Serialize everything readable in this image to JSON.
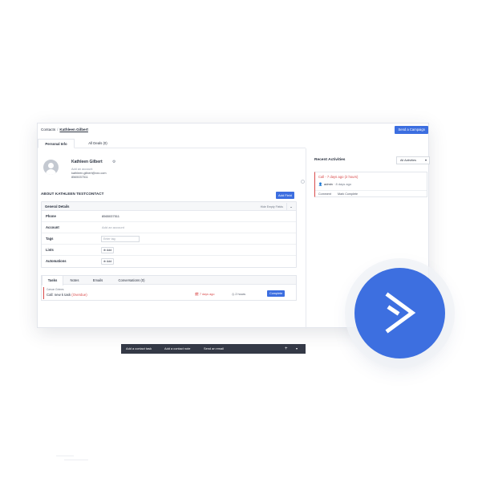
{
  "header": {
    "breadcrumb_root": "Contacts",
    "breadcrumb_sep": "/",
    "breadcrumb_current": "Kathleen Gilbert",
    "send_campaign_label": "Send a Campaign"
  },
  "tabs": [
    {
      "label": "Personal Info",
      "active": true
    },
    {
      "label": "All Deals (0)",
      "active": false
    }
  ],
  "contact": {
    "name": "Kathleen Gilbert",
    "account_link": "Add an account",
    "email": "kathleen.gilbert@xxx.com",
    "phone": "8565037511"
  },
  "about": {
    "title": "ABOUT KATHLEEN TESTCONTACT",
    "add_field_label": "Add Field"
  },
  "general_details": {
    "title": "General Details",
    "hide_empty_label": "Hide Empty Fields",
    "rows": [
      {
        "label": "Phone",
        "value": "8565037511"
      },
      {
        "label": "Account",
        "placeholder": "Add an account"
      },
      {
        "label": "Tags",
        "input_placeholder": "Enter tag"
      },
      {
        "label": "Lists",
        "add_label": "Add"
      },
      {
        "label": "Automations",
        "add_label": "Add"
      }
    ]
  },
  "task_tabs": [
    {
      "label": "Tasks",
      "active": true
    },
    {
      "label": "Notes",
      "active": false
    },
    {
      "label": "Emails",
      "active": false
    },
    {
      "label": "Conversations (0)",
      "active": false
    }
  ],
  "task": {
    "owner": "Carson Grimes",
    "title": "Call: new k task",
    "status": "(Overdue)",
    "due": "7 days ago",
    "duration": "2 hours",
    "complete_label": "Complete"
  },
  "bottom_bar": {
    "add_task": "Add a contact task",
    "add_note": "Add a contact note",
    "send_email": "Send an email",
    "plus": "+",
    "menu": "▾"
  },
  "recent_activities": {
    "title": "Recent Activities",
    "filter": "All Activities",
    "item": {
      "headline": "Call - 7 days ago (2 hours)",
      "user": "admin",
      "when": "· 8 days ago",
      "actions": [
        "Comment",
        "Mark Complete"
      ]
    }
  },
  "colors": {
    "brand_blue": "#3c6ee0",
    "overdue_red": "#d94b4b",
    "logo_blue": "#3d6fe0"
  },
  "icons": {
    "avatar": "person-silhouette-icon",
    "settings": "gear-icon",
    "collapse": "chevron-down-icon",
    "calendar": "calendar-icon",
    "clock": "clock-icon",
    "user": "user-icon",
    "logo": "activecampaign-chevron-icon"
  }
}
